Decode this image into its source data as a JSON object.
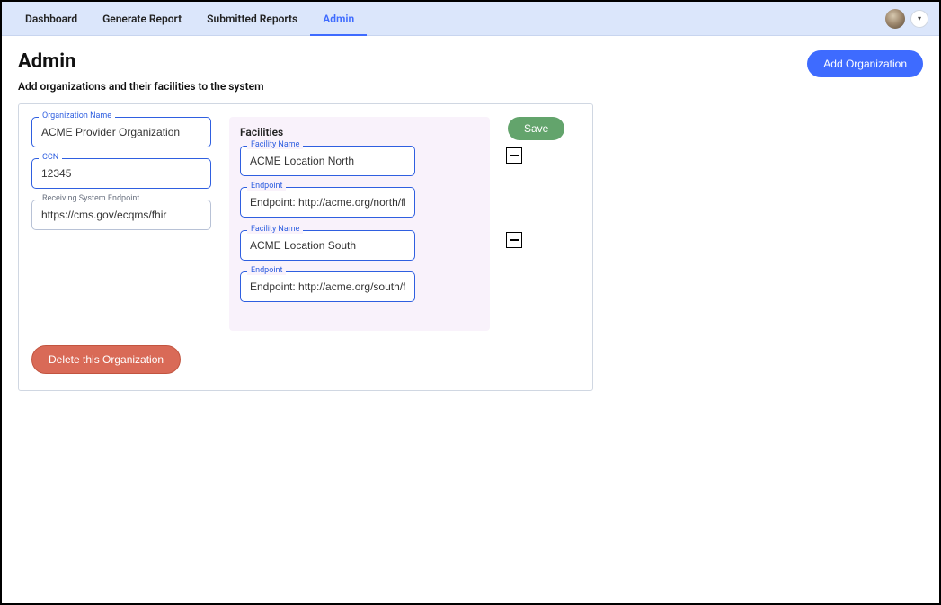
{
  "nav": {
    "tabs": [
      {
        "label": "Dashboard"
      },
      {
        "label": "Generate Report"
      },
      {
        "label": "Submitted Reports"
      },
      {
        "label": "Admin",
        "active": true
      }
    ]
  },
  "header": {
    "title": "Admin",
    "subtitle": "Add organizations and their facilities to the system",
    "add_button": "Add Organization"
  },
  "org": {
    "name_label": "Organization Name",
    "name_value": "ACME Provider Organization",
    "ccn_label": "CCN",
    "ccn_value": "12345",
    "endpoint_label": "Receiving System Endpoint",
    "endpoint_value": "https://cms.gov/ecqms/fhir",
    "delete_button": "Delete this Organization",
    "save_button": "Save"
  },
  "facilities": {
    "title": "Facilities",
    "items": [
      {
        "name_label": "Facility Name",
        "name_value": "ACME Location North",
        "endpoint_label": "Endpoint",
        "endpoint_value": "Endpoint: http://acme.org/north/fhir"
      },
      {
        "name_label": "Facility Name",
        "name_value": "ACME Location South",
        "endpoint_label": "Endpoint",
        "endpoint_value": "Endpoint: http://acme.org/south/fhir"
      }
    ]
  }
}
